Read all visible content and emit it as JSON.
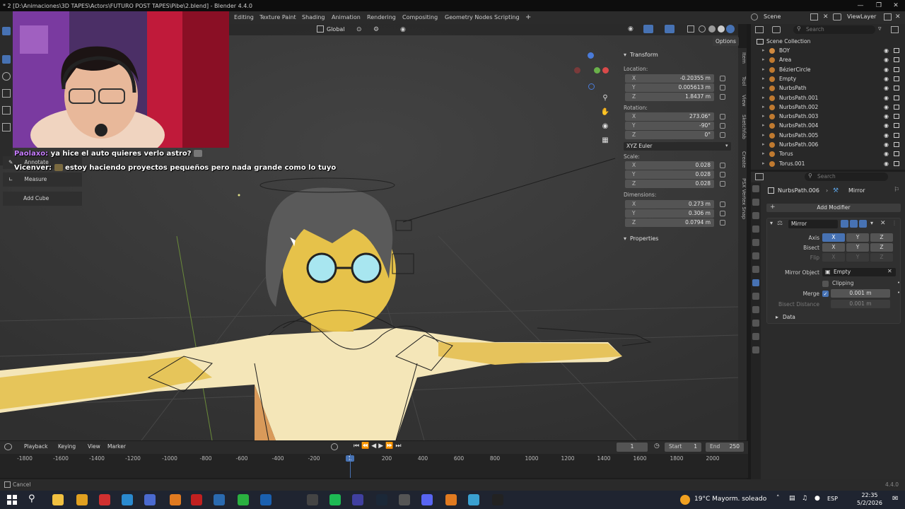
{
  "window": {
    "title": "* 2 [D:\\Animaciones\\3D TAPES\\Actors\\FUTURO POST TAPES\\Pibe\\2.blend] - Blender 4.4.0"
  },
  "workspaces": [
    "Editing",
    "Texture Paint",
    "Shading",
    "Animation",
    "Rendering",
    "Compositing",
    "Geometry Nodes",
    "Scripting"
  ],
  "topbar": {
    "add_tab": "+",
    "scene_label": "Scene",
    "viewlayer_label": "ViewLayer"
  },
  "viewport_header": {
    "orientation": "Global",
    "options_label": "Options"
  },
  "chat": [
    {
      "user": "Paolaxo:",
      "message": "ya hice el auto quieres verlo astro?",
      "user_color": "#c77dff"
    },
    {
      "user": "Vicenver:",
      "message": "estoy haciendo proyectos pequeños pero nada grande como lo tuyo",
      "user_color": "#ffffff"
    }
  ],
  "tools_popup": {
    "annotate": "Annotate",
    "measure": "Measure",
    "add_cube": "Add Cube"
  },
  "npanel": {
    "tabs": [
      "Item",
      "Tool",
      "View",
      "Sketchfab",
      "Create",
      "PSX Vertex Snap"
    ],
    "transform_header": "Transform",
    "location_label": "Location:",
    "location": [
      {
        "axis": "X",
        "value": "-0.20355 m"
      },
      {
        "axis": "Y",
        "value": "0.005613 m"
      },
      {
        "axis": "Z",
        "value": "1.8437 m"
      }
    ],
    "rotation_label": "Rotation:",
    "rotation": [
      {
        "axis": "X",
        "value": "273.06°"
      },
      {
        "axis": "Y",
        "value": "-90°"
      },
      {
        "axis": "Z",
        "value": "0°"
      }
    ],
    "rotation_mode": "XYZ Euler",
    "scale_label": "Scale:",
    "scale": [
      {
        "axis": "X",
        "value": "0.028"
      },
      {
        "axis": "Y",
        "value": "0.028"
      },
      {
        "axis": "Z",
        "value": "0.028"
      }
    ],
    "dimensions_label": "Dimensions:",
    "dimensions": [
      {
        "axis": "X",
        "value": "0.273 m"
      },
      {
        "axis": "Y",
        "value": "0.306 m"
      },
      {
        "axis": "Z",
        "value": "0.0794 m"
      }
    ],
    "properties_header": "Properties"
  },
  "outliner": {
    "search_placeholder": "Search",
    "root": "Scene Collection",
    "items": [
      "BOY",
      "Area",
      "BézierCircle",
      "Empty",
      "NurbsPath",
      "NurbsPath.001",
      "NurbsPath.002",
      "NurbsPath.003",
      "NurbsPath.004",
      "NurbsPath.005",
      "NurbsPath.006",
      "Torus",
      "Torus.001"
    ]
  },
  "properties": {
    "search_placeholder": "Search",
    "object_name": "NurbsPath.006",
    "modifier_tab": "Mirror",
    "add_modifier": "Add Modifier",
    "modifier_name": "Mirror",
    "axis_label": "Axis",
    "bisect_label": "Bisect",
    "flip_label": "Flip",
    "axes": [
      "X",
      "Y",
      "Z"
    ],
    "mirror_object_label": "Mirror Object",
    "mirror_object_value": "Empty",
    "clipping_label": "Clipping",
    "merge_label": "Merge",
    "merge_value": "0.001 m",
    "bisect_distance_label": "Bisect Distance",
    "bisect_distance_value": "0.001 m",
    "data_label": "Data"
  },
  "timeline": {
    "menus": [
      "Playback",
      "Keying",
      "View",
      "Marker"
    ],
    "current_frame": "1",
    "start_label": "Start",
    "start": "1",
    "end_label": "End",
    "end": "250",
    "ruler": [
      "-1800",
      "-1600",
      "-1400",
      "-1200",
      "-1000",
      "-800",
      "-600",
      "-400",
      "-200",
      "1",
      "200",
      "400",
      "600",
      "800",
      "1000",
      "1200",
      "1400",
      "1600",
      "1800",
      "2000"
    ]
  },
  "statusbar": {
    "left": "Cancel",
    "version": "4.4.0"
  },
  "taskbar": {
    "weather": "19°C  Mayorm. soleado",
    "lang": "ESP",
    "time": "22:35",
    "date": "5/2/2026"
  }
}
